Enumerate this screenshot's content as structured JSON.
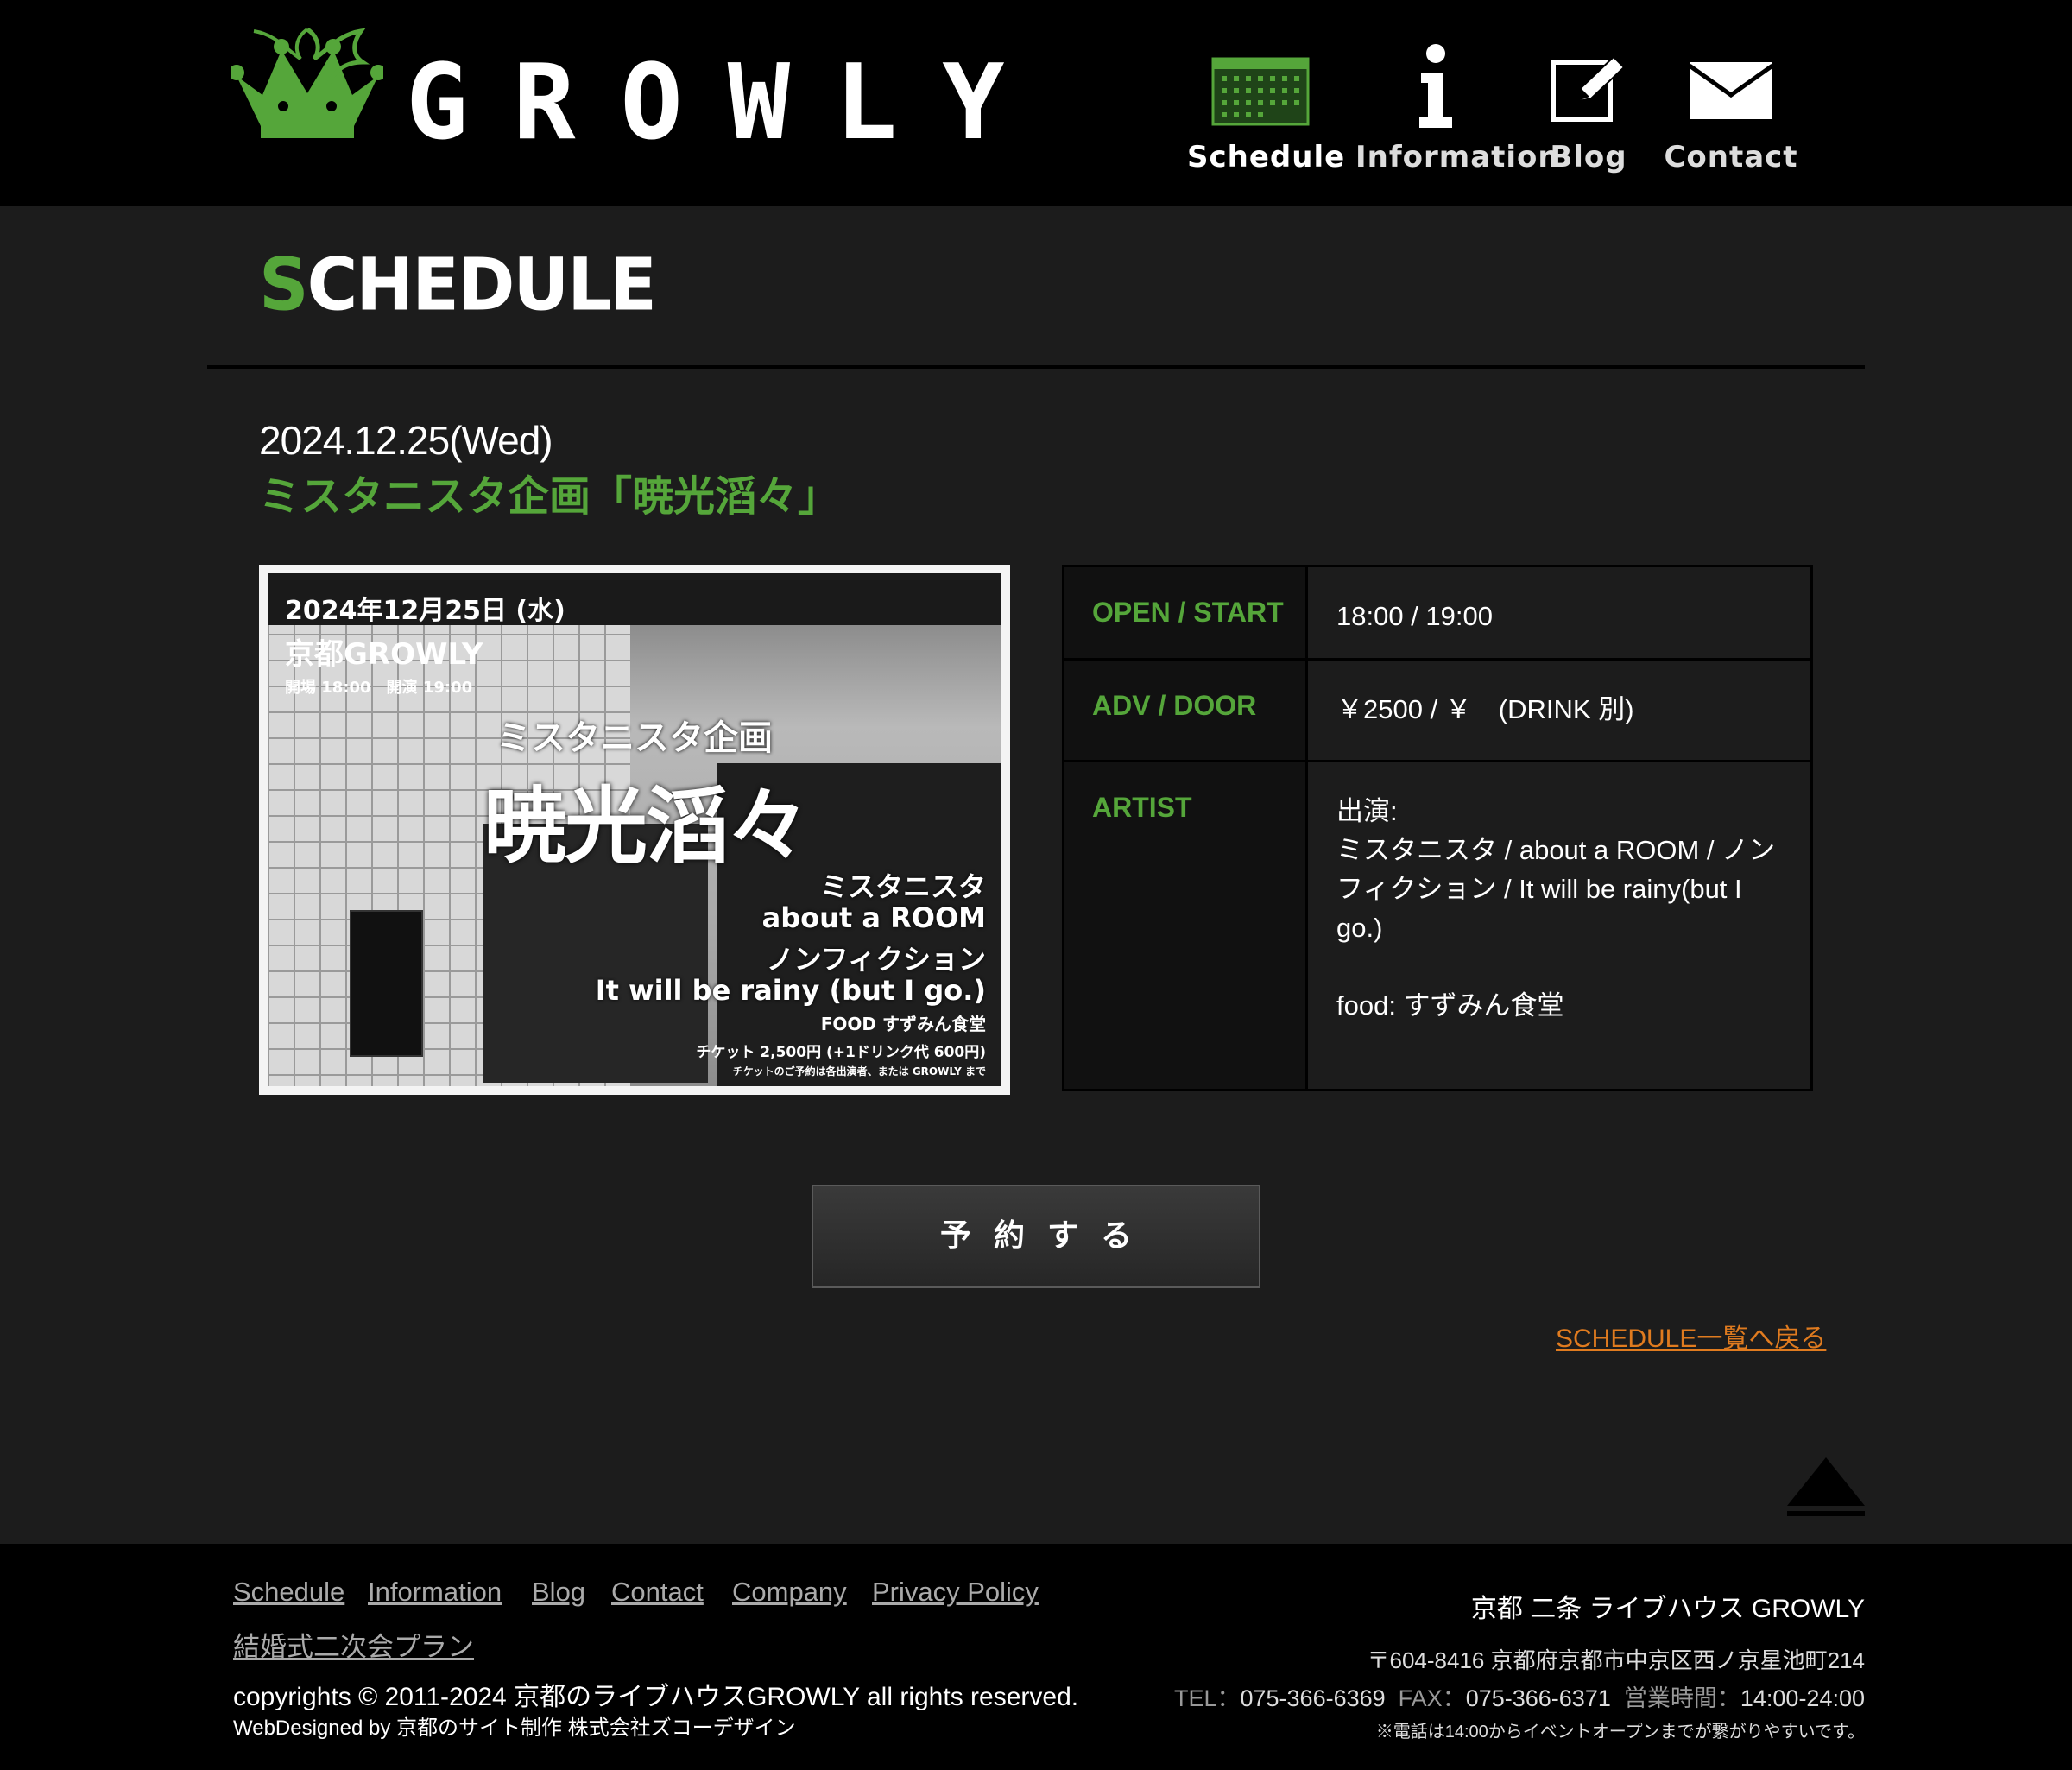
{
  "header": {
    "brand": "GROWLY",
    "nav": [
      {
        "label": "Schedule",
        "icon": "calendar-icon"
      },
      {
        "label": "Information",
        "icon": "info-icon"
      },
      {
        "label": "Blog",
        "icon": "pencil-edit-icon"
      },
      {
        "label": "Contact",
        "icon": "envelope-icon"
      }
    ]
  },
  "section": {
    "title_first": "S",
    "title_rest": "CHEDULE"
  },
  "event": {
    "date": "2024.12.25(Wed)",
    "title": "ミスタニスタ企画「暁光滔々」",
    "flyer": {
      "date": "2024年12月25日 (水)",
      "venue": "京都GROWLY",
      "times": "開場 18:00　開演 19:00",
      "subtitle": "ミスタニスタ企画",
      "title": "暁光滔々",
      "artists": [
        "ミスタニスタ",
        "about a ROOM",
        "ノンフィクション",
        "It will be rainy (but I go.)"
      ],
      "food": "FOOD すずみん食堂",
      "ticket": "チケット 2,500円 (+1ドリンク代 600円)",
      "note": "チケットのご予約は各出演者、または GROWLY まで"
    },
    "info": {
      "open_label": "OPEN / START",
      "open_value": "18:00 / 19:00",
      "price_label": "ADV / DOOR",
      "price_value": "￥2500 / ￥　(DRINK 別)",
      "artist_label": "ARTIST",
      "artist_heading": "出演:",
      "artist_list": "ミスタニスタ / about a ROOM / ノンフィクション / It will be rainy(but I go.)",
      "food": "food: すずみん食堂"
    }
  },
  "reserve_button": "予約する",
  "back_link": "SCHEDULE一覧へ戻る",
  "footer": {
    "links": [
      "Schedule",
      "Information",
      "Blog",
      "Contact",
      "Company",
      "Privacy Policy"
    ],
    "wedding_link": "結婚式二次会プラン",
    "copyright": "copyrights © 2011-2024 京都のライブハウスGROWLY all rights reserved.",
    "designed": "WebDesigned by 京都のサイト制作 株式会社ズコーデザイン",
    "venue": "京都 二条 ライブハウス GROWLY",
    "address": "〒604-8416 京都府京都市中京区西ノ京星池町214",
    "tel_label": "TEL：",
    "tel": "075-366-6369",
    "fax_label": "FAX：",
    "fax": "075-366-6371",
    "hours_label": "営業時間：",
    "hours": "14:00-24:00",
    "note": "※電話は14:00からイベントオープンまでが繋がりやすいです。"
  },
  "colors": {
    "accent": "#55a63a",
    "link_orange": "#e07b1f",
    "header_bg": "#000000",
    "page_bg": "#1c1c1c"
  }
}
